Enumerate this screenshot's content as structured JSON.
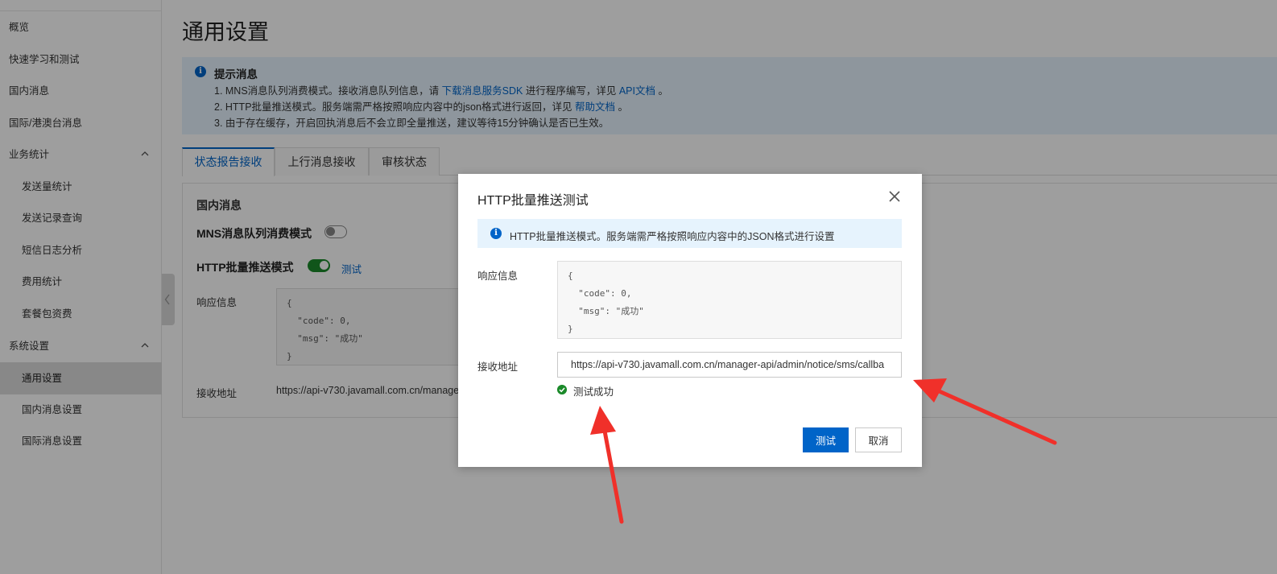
{
  "sidebar": {
    "items": [
      {
        "label": "概览"
      },
      {
        "label": "快速学习和测试"
      },
      {
        "label": "国内消息"
      },
      {
        "label": "国际/港澳台消息"
      },
      {
        "label": "业务统计"
      },
      {
        "label": "发送量统计"
      },
      {
        "label": "发送记录查询"
      },
      {
        "label": "短信日志分析"
      },
      {
        "label": "费用统计"
      },
      {
        "label": "套餐包资费"
      },
      {
        "label": "系统设置"
      },
      {
        "label": "通用设置"
      },
      {
        "label": "国内消息设置"
      },
      {
        "label": "国际消息设置"
      }
    ]
  },
  "page": {
    "title": "通用设置"
  },
  "notice": {
    "title": "提示消息",
    "line1_prefix": "1. MNS消息队列消费模式。接收消息队列信息，请 ",
    "line1_link1": "下载消息服务SDK",
    "line1_mid": " 进行程序编写，详见 ",
    "line1_link2": "API文档",
    "line1_suffix": " 。",
    "line2_prefix": "2. HTTP批量推送模式。服务端需严格按照响应内容中的json格式进行返回，详见 ",
    "line2_link": "帮助文档",
    "line2_suffix": " 。",
    "line3": "3. 由于存在缓存，开启回执消息后不会立即全量推送，建议等待15分钟确认是否已生效。"
  },
  "tabs": [
    {
      "label": "状态报告接收",
      "active": true
    },
    {
      "label": "上行消息接收",
      "active": false
    },
    {
      "label": "审核状态",
      "active": false
    }
  ],
  "panel": {
    "section_title": "国内消息",
    "mns_label": "MNS消息队列消费模式",
    "mns_enabled": false,
    "http_label": "HTTP批量推送模式",
    "http_enabled": true,
    "test_link": "测试",
    "response_label": "响应信息",
    "response_code": "{\n  \"code\": 0,\n  \"msg\": \"成功\"\n}",
    "address_label": "接收地址",
    "address_value": "https://api-v730.javamall.com.cn/manage"
  },
  "dialog": {
    "title": "HTTP批量推送测试",
    "info": "HTTP批量推送模式。服务端需严格按照响应内容中的JSON格式进行设置",
    "response_label": "响应信息",
    "response_code": "{\n  \"code\": 0,\n  \"msg\": \"成功\"\n}",
    "address_label": "接收地址",
    "address_value": "https://api-v730.javamall.com.cn/manager-api/admin/notice/sms/callba",
    "success_text": "测试成功",
    "test_button": "测试",
    "cancel_button": "取消"
  },
  "colors": {
    "accent": "#0064c8",
    "success": "#1b8a2a",
    "annotation": "#f0302a"
  }
}
